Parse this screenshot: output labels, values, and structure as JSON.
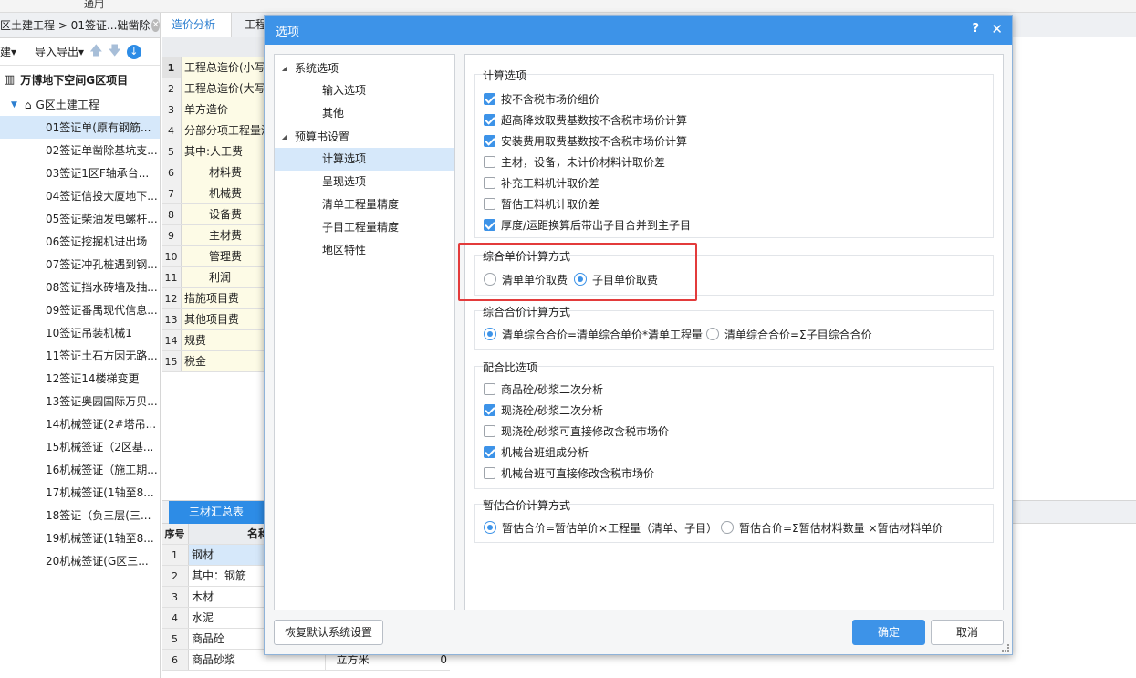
{
  "top": {
    "title": "通用"
  },
  "left": {
    "breadcrumb": "区土建工程 > 01签证...础凿除",
    "toolbar": {
      "new": "建▾",
      "import_export": "导入导出▾"
    },
    "project": "万博地下空间G区项目",
    "node": "G区土建工程",
    "items": [
      "01签证单(原有钢筋...",
      "02签证单凿除基坑支...",
      "03签证1区F轴承台...",
      "04签证信投大厦地下...",
      "05签证柴油发电螺杆...",
      "06签证挖掘机进出场",
      "07签证冲孔桩遇到钢...",
      "08签证挡水砖墙及抽...",
      "09签证番禺现代信息...",
      "10签证吊装机械1",
      "11签证土石方因无路...",
      "12签证14楼梯变更",
      "13签证奥园国际万贝...",
      "14机械签证(2#塔吊...",
      "15机械签证（2区基...",
      "16机械签证（施工期...",
      "17机械签证(1轴至8...",
      "18签证（负三层(三...",
      "19机械签证(1轴至8...",
      "20机械签证(G区三..."
    ]
  },
  "mid": {
    "tabs": [
      "造价分析",
      "工程"
    ],
    "rows": [
      {
        "num": "1",
        "name": "工程总造价(小写",
        "indent": false
      },
      {
        "num": "2",
        "name": "工程总造价(大写",
        "indent": false
      },
      {
        "num": "3",
        "name": "单方造价",
        "indent": false
      },
      {
        "num": "4",
        "name": "分部分项工程量清单",
        "indent": false
      },
      {
        "num": "5",
        "name": "其中:人工费",
        "indent": false
      },
      {
        "num": "6",
        "name": "材料费",
        "indent": true
      },
      {
        "num": "7",
        "name": "机械费",
        "indent": true
      },
      {
        "num": "8",
        "name": "设备费",
        "indent": true
      },
      {
        "num": "9",
        "name": "主材费",
        "indent": true
      },
      {
        "num": "10",
        "name": "管理费",
        "indent": true
      },
      {
        "num": "11",
        "name": "利润",
        "indent": true
      },
      {
        "num": "12",
        "name": "措施项目费",
        "indent": false
      },
      {
        "num": "13",
        "name": "其他项目费",
        "indent": false
      },
      {
        "num": "14",
        "name": "规费",
        "indent": false
      },
      {
        "num": "15",
        "name": "税金",
        "indent": false
      }
    ]
  },
  "bottom": {
    "tab": "三材汇总表",
    "headers": {
      "num": "序号",
      "name": "名称"
    },
    "rows": [
      {
        "num": "1",
        "name": "钢材",
        "unit": "",
        "qty": ""
      },
      {
        "num": "2",
        "name": "其中：钢筋",
        "unit": "",
        "qty": ""
      },
      {
        "num": "3",
        "name": "木材",
        "unit": "",
        "qty": ""
      },
      {
        "num": "4",
        "name": "水泥",
        "unit": "",
        "qty": ""
      },
      {
        "num": "5",
        "name": "商品砼",
        "unit": "",
        "qty": ""
      },
      {
        "num": "6",
        "name": "商品砂浆",
        "unit": "立方米",
        "qty": "0"
      }
    ]
  },
  "dialog": {
    "title": "选项",
    "help": "?",
    "close": "✕",
    "tree": {
      "group1": "系统选项",
      "group1_children": [
        "输入选项",
        "其他"
      ],
      "group2": "预算书设置",
      "group2_children": [
        "计算选项",
        "呈现选项",
        "清单工程量精度",
        "子目工程量精度",
        "地区特性"
      ]
    },
    "calc": {
      "title": "计算选项",
      "options": [
        {
          "label": "按不含税市场价组价",
          "checked": true
        },
        {
          "label": "超高降效取费基数按不含税市场价计算",
          "checked": true
        },
        {
          "label": "安装费用取费基数按不含税市场价计算",
          "checked": true
        },
        {
          "label": "主材，设备，未计价材料计取价差",
          "checked": false
        },
        {
          "label": "补充工料机计取价差",
          "checked": false
        },
        {
          "label": "暂估工料机计取价差",
          "checked": false
        },
        {
          "label": "厚度/运距换算后带出子目合并到主子目",
          "checked": true
        }
      ]
    },
    "unit_price": {
      "title": "综合单价计算方式",
      "options": [
        {
          "label": "清单单价取费",
          "selected": false
        },
        {
          "label": "子目单价取费",
          "selected": true
        }
      ]
    },
    "total_price": {
      "title": "综合合价计算方式",
      "options": [
        {
          "label": "清单综合合价=清单综合单价*清单工程量",
          "selected": true
        },
        {
          "label": "清单综合合价=Σ子目综合合价",
          "selected": false
        }
      ]
    },
    "mix": {
      "title": "配合比选项",
      "options": [
        {
          "label": "商品砼/砂浆二次分析",
          "checked": false
        },
        {
          "label": "现浇砼/砂浆二次分析",
          "checked": true
        },
        {
          "label": "现浇砼/砂浆可直接修改含税市场价",
          "checked": false
        },
        {
          "label": "机械台班组成分析",
          "checked": true
        },
        {
          "label": "机械台班可直接修改含税市场价",
          "checked": false
        }
      ]
    },
    "provisional": {
      "title": "暂估合价计算方式",
      "options": [
        {
          "label": "暂估合价=暂估单价×工程量（清单、子目）",
          "selected": true
        },
        {
          "label": "暂估合价=Σ暂估材料数量 ×暂估材料单价",
          "selected": false
        }
      ]
    },
    "buttons": {
      "restore": "恢复默认系统设置",
      "ok": "确定",
      "cancel": "取消"
    }
  }
}
